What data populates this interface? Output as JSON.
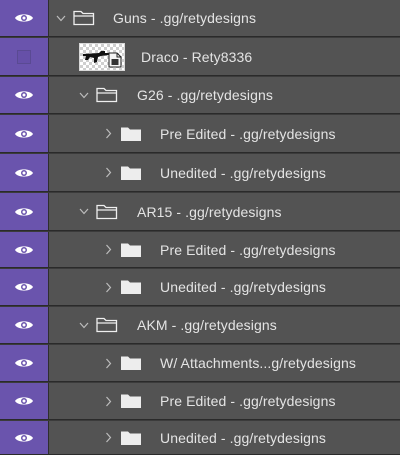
{
  "colors": {
    "visibility_column": "#6a54ad",
    "row_background": "#535353",
    "row_border": "#2a2a2a",
    "text": "#e4e4e4"
  },
  "layers": [
    {
      "name": "Guns - .gg/retydesigns",
      "type": "group",
      "expanded": true,
      "visible": true
    },
    {
      "name": "Draco - Rety8336",
      "type": "smart-object",
      "visible": false
    },
    {
      "name": "G26 - .gg/retydesigns",
      "type": "group",
      "expanded": true,
      "visible": true
    },
    {
      "name": "Pre Edited - .gg/retydesigns",
      "type": "group",
      "expanded": false,
      "visible": true
    },
    {
      "name": "Unedited - .gg/retydesigns",
      "type": "group",
      "expanded": false,
      "visible": true
    },
    {
      "name": "AR15 - .gg/retydesigns",
      "type": "group",
      "expanded": true,
      "visible": true
    },
    {
      "name": "Pre Edited - .gg/retydesigns",
      "type": "group",
      "expanded": false,
      "visible": true
    },
    {
      "name": "Unedited - .gg/retydesigns",
      "type": "group",
      "expanded": false,
      "visible": true
    },
    {
      "name": "AKM - .gg/retydesigns",
      "type": "group",
      "expanded": true,
      "visible": true
    },
    {
      "name": "W/ Attachments...g/retydesigns",
      "type": "group",
      "expanded": false,
      "visible": true
    },
    {
      "name": "Pre Edited - .gg/retydesigns",
      "type": "group",
      "expanded": false,
      "visible": true
    },
    {
      "name": "Unedited - .gg/retydesigns",
      "type": "group",
      "expanded": false,
      "visible": true
    }
  ]
}
